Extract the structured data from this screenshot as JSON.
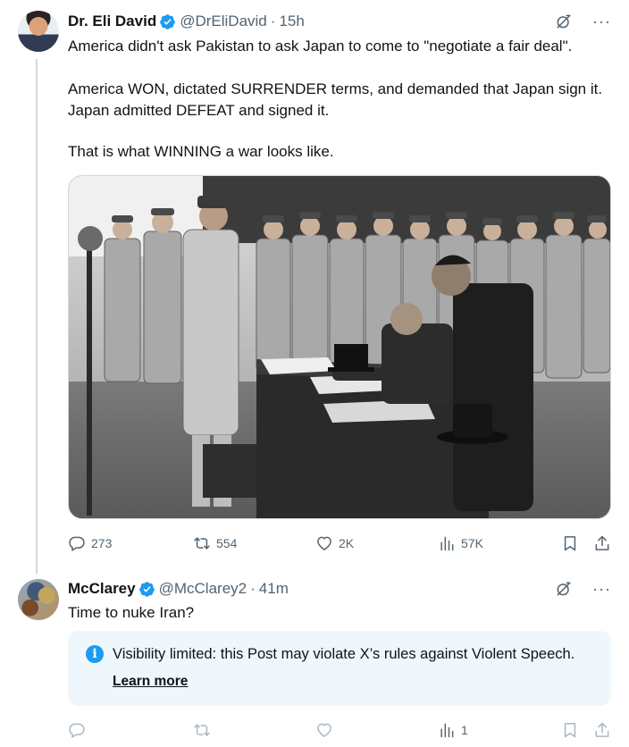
{
  "tweets": [
    {
      "author_name": "Dr. Eli David",
      "handle": "@DrEliDavid",
      "separator": "·",
      "time": "15h",
      "text_lines": [
        "America didn't ask Pakistan to ask Japan to come to \"negotiate a fair deal\".",
        "America WON, dictated SURRENDER terms, and demanded that Japan sign it. Japan admitted DEFEAT and signed it.",
        "That is what WINNING a war looks like."
      ],
      "stats": {
        "replies": "273",
        "reposts": "554",
        "likes": "2K",
        "views": "57K"
      }
    },
    {
      "author_name": "McClarey",
      "handle": "@McClarey2",
      "separator": "·",
      "time": "41m",
      "text": "Time to nuke Iran?",
      "notice": {
        "icon": "info-icon",
        "glyph": "i",
        "message": "Visibility limited: this Post may violate X’s rules against Violent Speech.",
        "link": "Learn more"
      },
      "stats": {
        "views": "1"
      }
    }
  ],
  "icons": {
    "verified": "verified-badge-icon",
    "grok": "grok-icon",
    "more": "more-icon",
    "reply": "reply-icon",
    "repost": "repost-icon",
    "like": "like-icon",
    "views": "views-icon",
    "bookmark": "bookmark-icon",
    "share": "share-icon"
  },
  "more_glyph": "···",
  "colors": {
    "verified": "#1d9bf0",
    "secondary_text": "#536471",
    "notice_bg": "#eff7fc"
  }
}
